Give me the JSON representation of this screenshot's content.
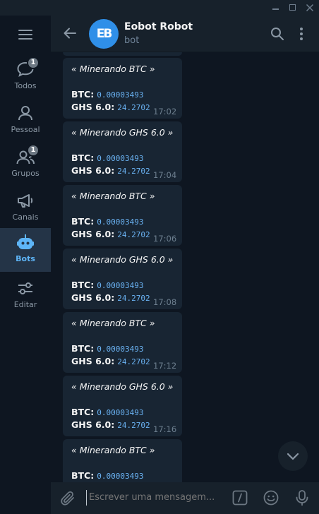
{
  "window": {
    "controls": [
      "minimize-icon",
      "maximize-icon",
      "close-icon"
    ]
  },
  "sidebar": {
    "menu_icon": "hamburger-icon",
    "folders": [
      {
        "label": "Todos",
        "icon": "chats-icon",
        "badge": "1",
        "active": false
      },
      {
        "label": "Pessoal",
        "icon": "person-icon",
        "badge": "",
        "active": false
      },
      {
        "label": "Grupos",
        "icon": "group-icon",
        "badge": "1",
        "active": false
      },
      {
        "label": "Canais",
        "icon": "megaphone-icon",
        "badge": "",
        "active": false
      },
      {
        "label": "Bots",
        "icon": "bot-icon",
        "badge": "",
        "active": true
      },
      {
        "label": "Editar",
        "icon": "sliders-icon",
        "badge": "",
        "active": false
      }
    ]
  },
  "header": {
    "title": "Eobot Robot",
    "subtitle": "bot",
    "avatar_text": "EB"
  },
  "messages": [
    {
      "title": "«  Minerando BTC  »",
      "btc_label": "BTC:",
      "btc_value": "0.00003493",
      "ghs_label": "GHS 6.0:",
      "ghs_value": "24.2702",
      "time": "17:02"
    },
    {
      "title": "«  Minerando GHS 6.0  »",
      "btc_label": "BTC:",
      "btc_value": "0.00003493",
      "ghs_label": "GHS 6.0:",
      "ghs_value": "24.2702",
      "time": "17:04"
    },
    {
      "title": "«  Minerando BTC  »",
      "btc_label": "BTC:",
      "btc_value": "0.00003493",
      "ghs_label": "GHS 6.0:",
      "ghs_value": "24.2702",
      "time": "17:06"
    },
    {
      "title": "«  Minerando GHS 6.0  »",
      "btc_label": "BTC:",
      "btc_value": "0.00003493",
      "ghs_label": "GHS 6.0:",
      "ghs_value": "24.2702",
      "time": "17:08"
    },
    {
      "title": "«  Minerando BTC  »",
      "btc_label": "BTC:",
      "btc_value": "0.00003493",
      "ghs_label": "GHS 6.0:",
      "ghs_value": "24.2702",
      "time": "17:12"
    },
    {
      "title": "«  Minerando GHS 6.0  »",
      "btc_label": "BTC:",
      "btc_value": "0.00003493",
      "ghs_label": "GHS 6.0:",
      "ghs_value": "24.2702",
      "time": "17:16"
    },
    {
      "title": "«  Minerando BTC  »",
      "btc_label": "BTC:",
      "btc_value": "0.00003493",
      "ghs_label": "",
      "ghs_value": "",
      "time": ""
    }
  ],
  "composer": {
    "placeholder": "Escrever uma mensagem..."
  },
  "colors": {
    "accent": "#5eb5f7",
    "code": "#6ab2f2",
    "bubble": "#182533",
    "background": "#0e1621",
    "panel": "#17212b"
  }
}
